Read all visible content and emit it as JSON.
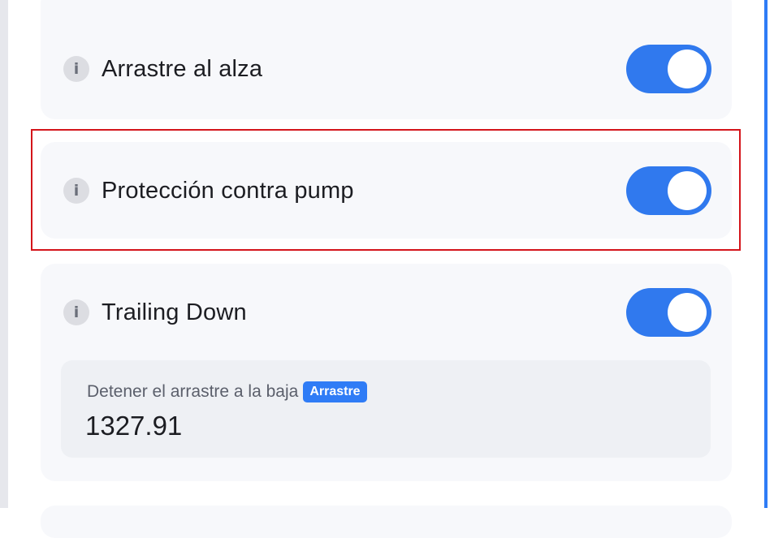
{
  "settings": [
    {
      "label": "Arrastre al alza",
      "enabled": true
    },
    {
      "label": "Protección contra pump",
      "enabled": true
    },
    {
      "label": "Trailing Down",
      "enabled": true
    }
  ],
  "trailing_down_field": {
    "label": "Detener el arrastre a la baja",
    "badge": "Arrastre",
    "value": "1327.91"
  },
  "colors": {
    "accent": "#3079ee",
    "highlight": "#d4151b",
    "card_bg": "#f7f8fb"
  },
  "icons": {
    "info": "i"
  }
}
